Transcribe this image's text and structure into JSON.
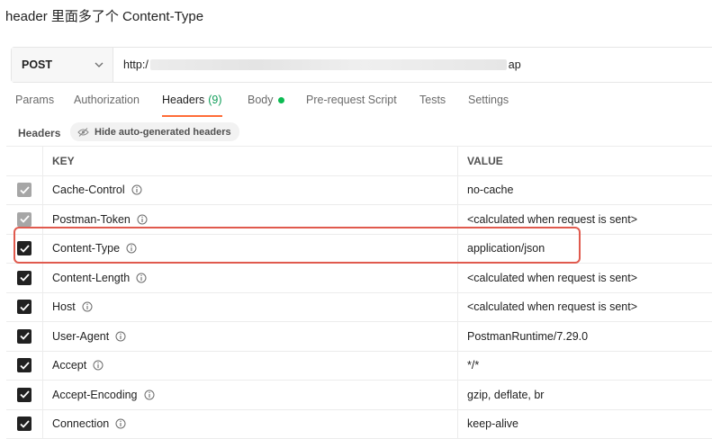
{
  "caption": "header 里面多了个 Content-Type",
  "request": {
    "method": "POST",
    "url_prefix": "http:/",
    "url_suffix": "ap"
  },
  "tabs": [
    {
      "label": "Params"
    },
    {
      "label": "Authorization"
    },
    {
      "label": "Headers",
      "count": "(9)",
      "active": true
    },
    {
      "label": "Body"
    },
    {
      "label": "Pre-request Script"
    },
    {
      "label": "Tests"
    },
    {
      "label": "Settings"
    }
  ],
  "headers_section": {
    "label": "Headers",
    "hide_button": "Hide auto-generated headers"
  },
  "table": {
    "columns": {
      "key": "KEY",
      "value": "VALUE"
    },
    "rows": [
      {
        "key": "Cache-Control",
        "value": "no-cache",
        "checked": "dim"
      },
      {
        "key": "Postman-Token",
        "value": "<calculated when request is sent>",
        "checked": "dim"
      },
      {
        "key": "Content-Type",
        "value": "application/json",
        "checked": "on"
      },
      {
        "key": "Content-Length",
        "value": "<calculated when request is sent>",
        "checked": "on"
      },
      {
        "key": "Host",
        "value": "<calculated when request is sent>",
        "checked": "on"
      },
      {
        "key": "User-Agent",
        "value": "PostmanRuntime/7.29.0",
        "checked": "on"
      },
      {
        "key": "Accept",
        "value": "*/*",
        "checked": "on"
      },
      {
        "key": "Accept-Encoding",
        "value": "gzip, deflate, br",
        "checked": "on"
      },
      {
        "key": "Connection",
        "value": "keep-alive",
        "checked": "on"
      }
    ]
  },
  "colors": {
    "accent_tab": "#ff6c37",
    "count_green": "#0f9d58",
    "body_dot": "#0cbb52",
    "highlight": "#e05a4e"
  }
}
